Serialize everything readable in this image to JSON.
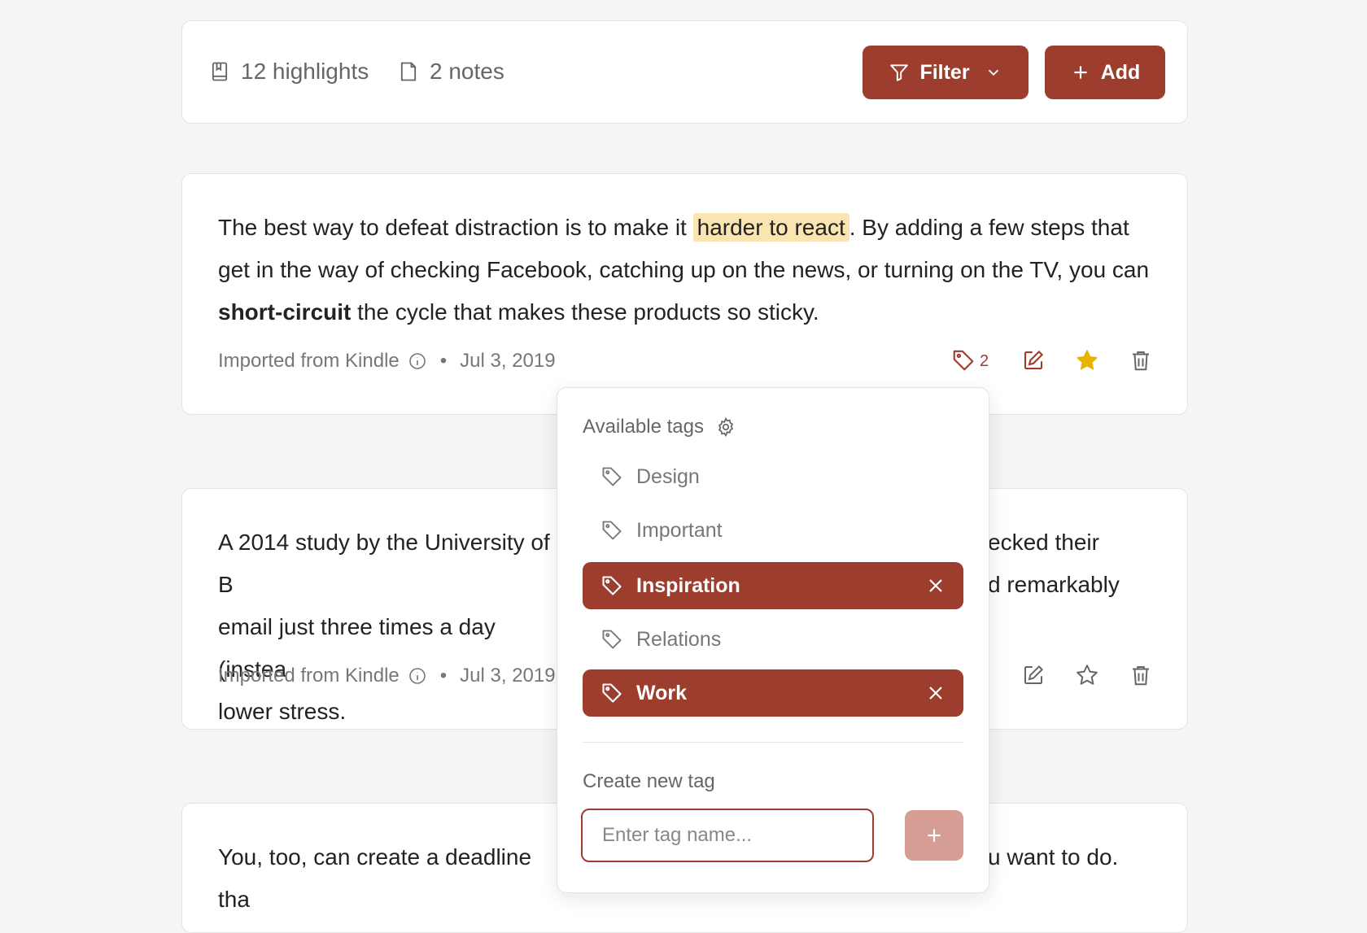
{
  "toolbar": {
    "highlights": "12 highlights",
    "notes": "2 notes",
    "filter_label": "Filter",
    "add_label": "Add"
  },
  "cards": [
    {
      "text_pre": "The best way to defeat distraction is to make it ",
      "highlight": "harder to react",
      "text_mid": ". By adding a few steps that get in the way of checking Facebook, catching up on the news, or turning on the TV, you can ",
      "bold": "short-circuit",
      "text_post": " the cycle that makes these products so sticky.",
      "source": "Imported from Kindle",
      "date": "Jul 3, 2019",
      "tag_count": "2",
      "starred": true
    },
    {
      "text_left_lines": [
        "A 2014 study by the University of B",
        "email just three times a day (instea",
        "lower stress."
      ],
      "text_right_lines": [
        "ecked their",
        "d remarkably"
      ],
      "source": "Imported from Kindle",
      "date": "Jul 3, 2019",
      "starred": false
    },
    {
      "text_left": "You, too, can create a deadline tha",
      "text_right": "u want to do."
    }
  ],
  "tag_popover": {
    "title": "Available tags",
    "tags": [
      {
        "label": "Design",
        "selected": false
      },
      {
        "label": "Important",
        "selected": false
      },
      {
        "label": "Inspiration",
        "selected": true
      },
      {
        "label": "Relations",
        "selected": false
      },
      {
        "label": "Work",
        "selected": true
      }
    ],
    "create_label": "Create new tag",
    "input_placeholder": "Enter tag name..."
  },
  "colors": {
    "accent": "#9c3d2e",
    "highlight": "#fae4b0",
    "star": "#e8b400"
  }
}
